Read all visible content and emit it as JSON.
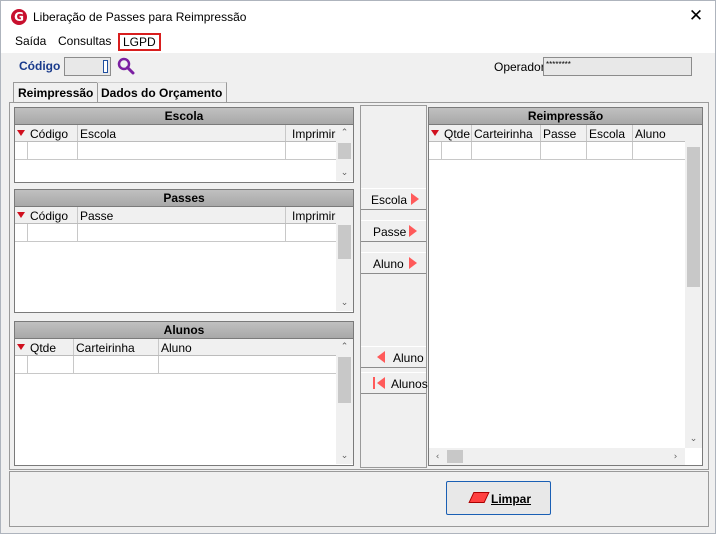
{
  "window": {
    "title": "Liberação de Passes para Reimpressão",
    "close_glyph": "✕",
    "icon_letter": "G"
  },
  "menu": {
    "items": [
      "Saída",
      "Consultas",
      "LGPD"
    ],
    "highlight_color": "#d81e1e"
  },
  "header": {
    "code_label": "Código",
    "operator_label": "Operador",
    "operator_value": "********"
  },
  "tabs": [
    {
      "label": "Reimpressão",
      "active": true
    },
    {
      "label": "Dados do Orçamento",
      "active": false
    }
  ],
  "panels": {
    "escola": {
      "title": "Escola",
      "columns": [
        "Código",
        "Escola",
        "Imprimir"
      ]
    },
    "passes": {
      "title": "Passes",
      "columns": [
        "Código",
        "Passe",
        "Imprimir"
      ]
    },
    "alunos": {
      "title": "Alunos",
      "columns": [
        "Qtde",
        "Carteirinha",
        "Aluno"
      ]
    },
    "reimpressao": {
      "title": "Reimpressão",
      "columns": [
        "Qtde",
        "Carteirinha",
        "Passe",
        "Escola",
        "Aluno"
      ]
    }
  },
  "move_buttons": {
    "escola": "Escola",
    "passe": "Passe",
    "aluno": "Aluno",
    "remove_aluno": "Aluno",
    "remove_alunos": "Alunos"
  },
  "footer": {
    "clear_label": "Limpar"
  },
  "colors": {
    "accent_red": "#ff5a5a",
    "title_blue": "#1a3b8c",
    "brand_red": "#c8102e"
  }
}
